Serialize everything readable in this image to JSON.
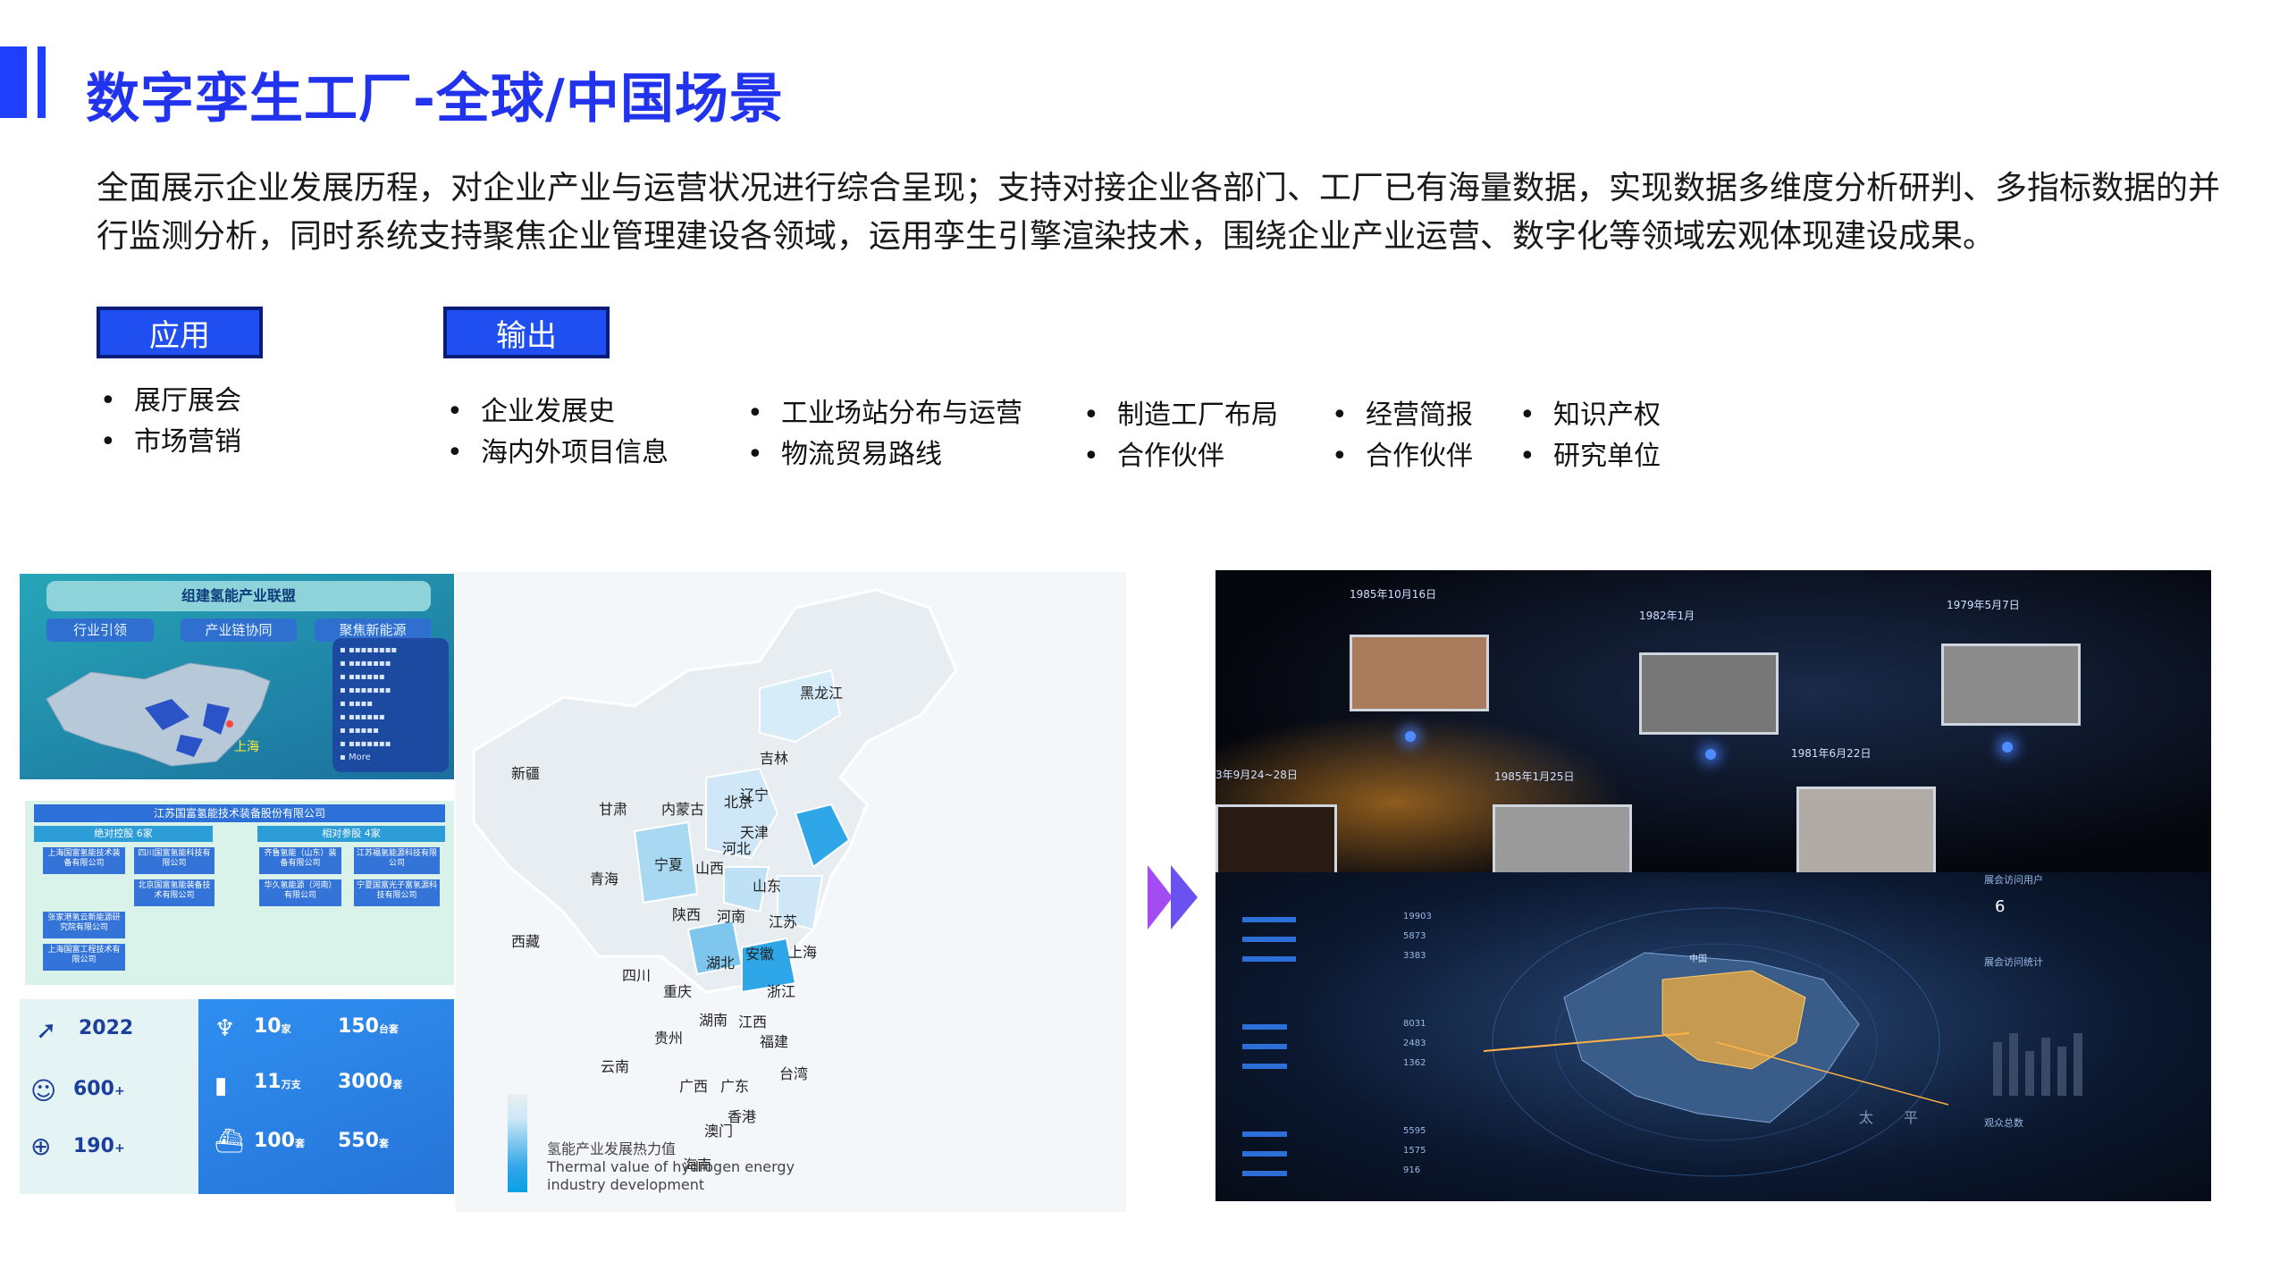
{
  "header": {
    "title": "数字孪生工厂-全球/中国场景",
    "description": " 全面展示企业发展历程，对企业产业与运营状况进行综合呈现；支持对接企业各部门、工厂已有海量数据，实现数据多维度分析研判、多指标数据的并行监测分析，同时系统支持聚焦企业管理建设各领域，运用孪生引擎渲染技术，围绕企业产业运营、数字化等领域宏观体现建设成果。"
  },
  "apply": {
    "label": "应用",
    "items": [
      "展厅展会",
      "市场营销"
    ]
  },
  "output": {
    "label": "输出",
    "columns": [
      [
        "企业发展史",
        "海内外项目信息"
      ],
      [
        "工业场站分布与运营",
        "物流贸易路线"
      ],
      [
        "制造工厂布局",
        "合作伙伴"
      ],
      [
        "经营简报",
        "合作伙伴"
      ],
      [
        "知识产权",
        "研究单位"
      ]
    ]
  },
  "panel_alliance": {
    "title": "组建氢能产业联盟",
    "pills": [
      "行业引领",
      "产业链协同",
      "聚焦新能源"
    ],
    "city": "上海",
    "list_more": "More"
  },
  "panel_org": {
    "title": "江苏国富氢能技术装备股份有限公司",
    "group_a": "绝对控股 6家",
    "group_b": "相对参股 4家",
    "companies": [
      "上海国富氢能技术装备有限公司",
      "四川国富氢能科技有限公司",
      "北京国富氢能装备技术有限公司",
      "华久氢能源（河南）有限公司",
      "齐鲁氢能（山东）装备有限公司",
      "江苏福氢能源科技有限公司",
      "宁夏国富光子富氢源科技有限公司",
      "张家港氢云新能源研究院有限公司",
      "上海国富工程技术有限公司"
    ]
  },
  "panel_stats": {
    "items": [
      {
        "value": "2022",
        "unit": ""
      },
      {
        "value": "600",
        "unit": "+"
      },
      {
        "value": "190",
        "unit": "+"
      },
      {
        "value": "10",
        "unit": "家"
      },
      {
        "value": "150",
        "unit": "台套"
      },
      {
        "value": "11",
        "unit": "万支"
      },
      {
        "value": "3000",
        "unit": "套"
      },
      {
        "value": "100",
        "unit": "套"
      },
      {
        "value": "550",
        "unit": "套"
      }
    ]
  },
  "china_map": {
    "provinces": [
      "黑龙江",
      "吉林",
      "辽宁",
      "新疆",
      "内蒙古",
      "北京",
      "天津",
      "甘肃",
      "宁夏",
      "山西",
      "河北",
      "青海",
      "山东",
      "陕西",
      "河南",
      "江苏",
      "西藏",
      "四川",
      "湖北",
      "安徽",
      "上海",
      "重庆",
      "浙江",
      "湖南",
      "江西",
      "贵州",
      "福建",
      "云南",
      "广西",
      "广东",
      "台湾",
      "香港",
      "澳门",
      "海南"
    ],
    "legend_cn": "氢能产业发展热力值",
    "legend_en_1": "Thermal value of hydrogen energy",
    "legend_en_2": "industry development",
    "colors": {
      "low": "#e9eef2",
      "mid": "#7ec6ee",
      "high": "#0aa0e6"
    }
  },
  "globe_panel": {
    "dates": [
      "1985年10月16日",
      "1982年1月",
      "1979年5月7日",
      "1985年1月25日",
      "1981年6月22日",
      "3年9月24~28日"
    ],
    "side_labels": [
      "展会访问用户",
      "展会访问统计",
      "观众总数"
    ],
    "side_value": "6",
    "hud_values": [
      "19903",
      "5873",
      "3383",
      "8031",
      "2483",
      "1362",
      "5595",
      "1575",
      "916"
    ],
    "map_text": [
      "太",
      "平"
    ],
    "country": "中国"
  }
}
